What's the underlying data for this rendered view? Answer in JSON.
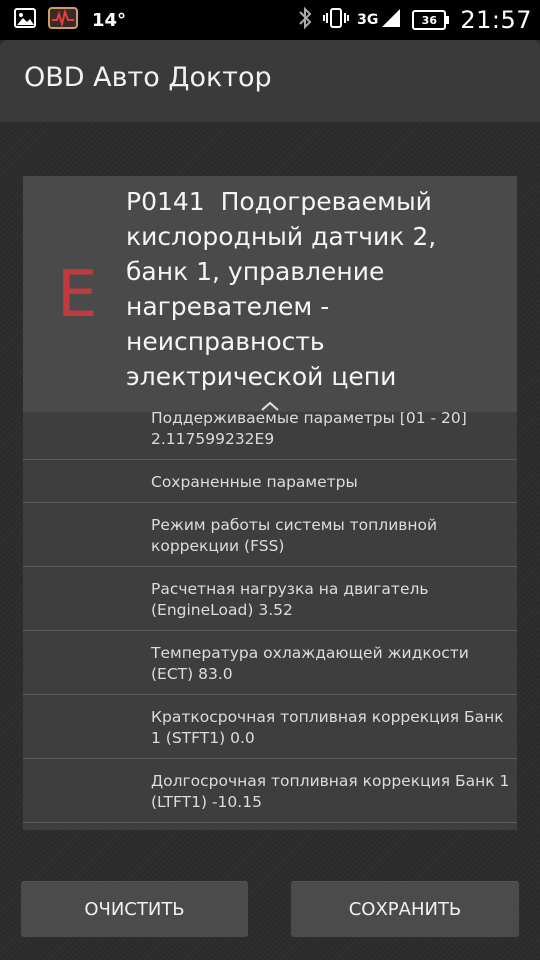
{
  "status_bar": {
    "temperature": "14°",
    "network": "3G",
    "battery": "36",
    "time": "21:57",
    "icons": [
      "gallery-icon",
      "app-monitor-icon",
      "bluetooth-icon",
      "vibrate-icon",
      "signal-icon"
    ]
  },
  "app": {
    "title": "OBD Авто Доктор"
  },
  "trouble_code": {
    "letter": "E",
    "title": "P0141  Подогреваемый кислородный датчик 2, банк 1, управление нагревателем - неисправность электрической цепи",
    "letter_color": "#c03a3e"
  },
  "list": {
    "items": [
      {
        "text": "Поддерживаемые параметры [01 - 20]\n2.117599232E9"
      },
      {
        "text": "Сохраненные параметры"
      },
      {
        "text": "Режим работы системы топливной\nкоррекции (FSS)"
      },
      {
        "text": "Расчетная нагрузка на двигатель\n(EngineLoad) 3.52"
      },
      {
        "text": "Температура охлаждающей жидкости\n(ECT) 83.0"
      },
      {
        "text": "Краткосрочная топливная коррекция Банк\n1 (STFT1) 0.0"
      },
      {
        "text": "Долгосрочная топливная коррекция Банк 1\n(LTFT1) -10.15"
      }
    ]
  },
  "buttons": {
    "clear_label": "ОЧИСТИТЬ",
    "save_label": "СОХРАНИТЬ"
  }
}
